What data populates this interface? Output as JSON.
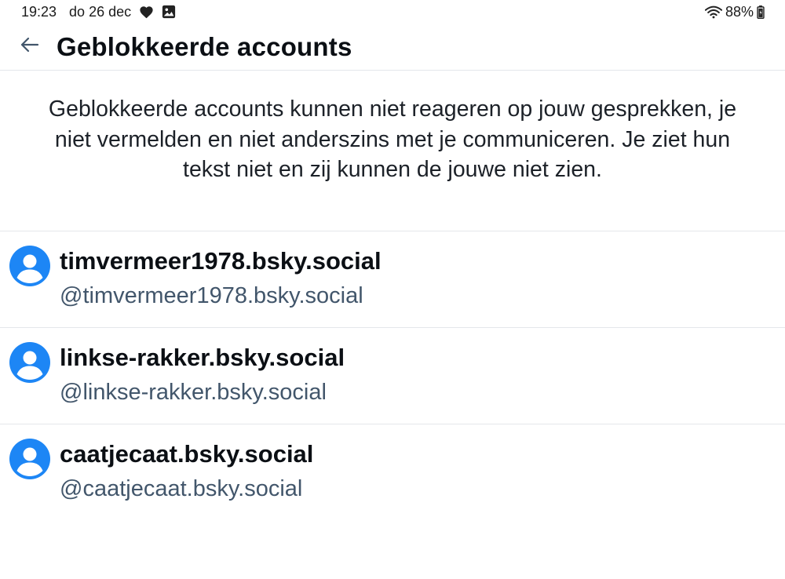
{
  "status_bar": {
    "time": "19:23",
    "date": "do 26 dec",
    "battery": "88%",
    "icons": [
      "heart-icon",
      "image-icon",
      "wifi-icon",
      "battery-icon"
    ]
  },
  "header": {
    "back_icon": "arrow-left-icon",
    "title": "Geblokkeerde accounts"
  },
  "description": "Geblokkeerde accounts kunnen niet reageren op jouw gesprekken, je niet vermelden en niet anderszins met je communiceren. Je ziet hun tekst niet en zij kunnen de jouwe niet zien.",
  "accounts": [
    {
      "name": "timvermeer1978.bsky.social",
      "handle": "@timvermeer1978.bsky.social"
    },
    {
      "name": "linkse-rakker.bsky.social",
      "handle": "@linkse-rakker.bsky.social"
    },
    {
      "name": "caatjecaat.bsky.social",
      "handle": "@caatjecaat.bsky.social"
    }
  ],
  "colors": {
    "accent": "#1d86f5",
    "handle_text": "#42566b",
    "divider": "#e4e7eb"
  }
}
